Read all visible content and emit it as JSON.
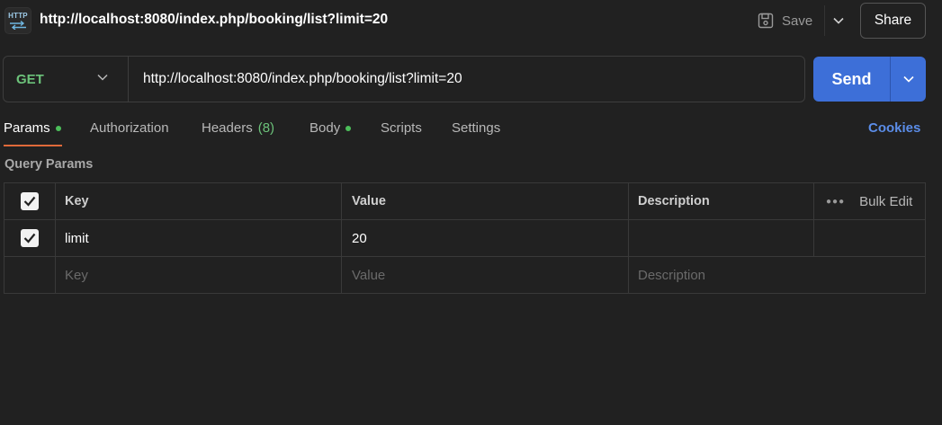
{
  "header": {
    "icon_text": "HTTP",
    "title": "http://localhost:8080/index.php/booking/list?limit=20",
    "save_label": "Save",
    "share_label": "Share"
  },
  "request": {
    "method": "GET",
    "method_color": "#6cc27a",
    "url": "http://localhost:8080/index.php/booking/list?limit=20",
    "send_label": "Send",
    "send_color": "#3d6fd8"
  },
  "tabs": [
    {
      "label": "Params",
      "active": true,
      "dot": true
    },
    {
      "label": "Authorization"
    },
    {
      "label": "Headers",
      "count": "(8)"
    },
    {
      "label": "Body",
      "dot": true
    },
    {
      "label": "Scripts"
    },
    {
      "label": "Settings"
    }
  ],
  "cookies_label": "Cookies",
  "section_label": "Query Params",
  "table": {
    "columns": [
      "Key",
      "Value",
      "Description"
    ],
    "bulk_edit_label": "Bulk Edit",
    "rows": [
      {
        "checked": true,
        "key": "limit",
        "value": "20",
        "description": ""
      }
    ],
    "placeholders": {
      "key": "Key",
      "value": "Value",
      "description": "Description"
    }
  },
  "icons": {
    "http": "http-icon",
    "save": "save-icon",
    "chevron": "chevron-down-icon",
    "check": "check-icon",
    "more": "more-dots-icon"
  },
  "accent": {
    "active_tab_underline": "#e06a3a",
    "dot": "#4cbf5a",
    "link": "#5b8de8"
  }
}
